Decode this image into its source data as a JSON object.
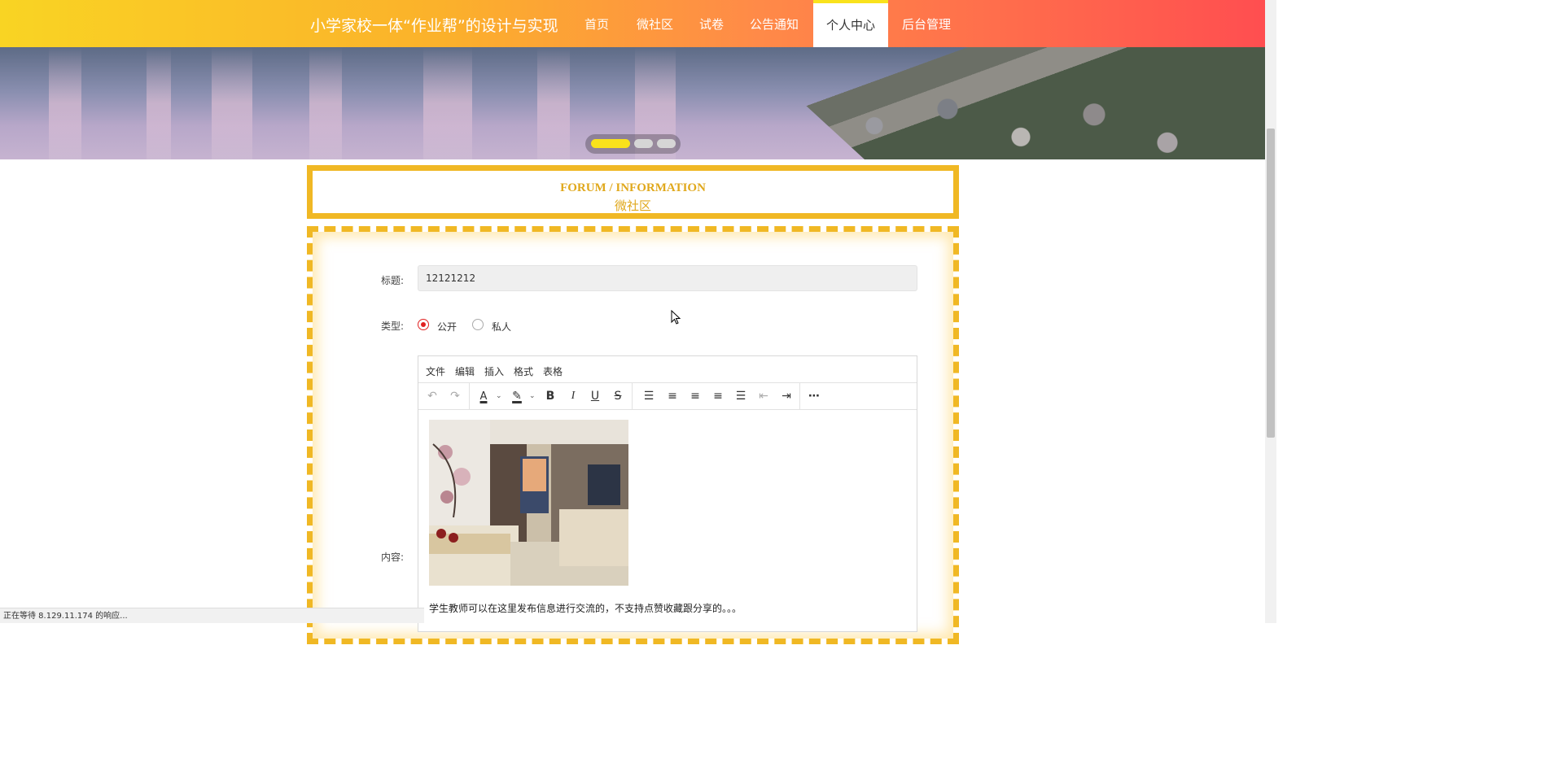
{
  "header": {
    "site_title": "小学家校一体“作业帮”的设计与实现",
    "nav": [
      {
        "label": "首页"
      },
      {
        "label": "微社区"
      },
      {
        "label": "试卷"
      },
      {
        "label": "公告通知"
      },
      {
        "label": "个人中心",
        "active": true
      },
      {
        "label": "后台管理"
      }
    ]
  },
  "banner": {
    "slides": 3,
    "active_slide": 1
  },
  "section": {
    "title_en": "FORUM / INFORMATION",
    "title_cn": "微社区"
  },
  "form": {
    "title_label": "标题:",
    "title_value": "12121212",
    "type_label": "类型:",
    "type_options": [
      {
        "label": "公开",
        "selected": true
      },
      {
        "label": "私人",
        "selected": false
      }
    ],
    "content_label": "内容:",
    "editor": {
      "menus": [
        "文件",
        "编辑",
        "插入",
        "格式",
        "表格"
      ],
      "toolbar_icons": [
        "undo-icon",
        "redo-icon",
        "text-color-icon",
        "highlight-icon",
        "bold-icon",
        "italic-icon",
        "underline-icon",
        "strikethrough-icon",
        "line-height-icon",
        "align-left-icon",
        "align-center-icon",
        "align-right-icon",
        "align-justify-icon",
        "outdent-icon",
        "indent-icon",
        "more-icon"
      ],
      "content_text": "学生教师可以在这里发布信息进行交流的，不支持点赞收藏跟分享的。。。"
    }
  },
  "status_bar": {
    "text": "正在等待 8.129.11.174 的响应..."
  },
  "colors": {
    "accent_yellow": "#f0b824",
    "header_start": "#f9d423",
    "header_end": "#ff4e50",
    "radio_red": "#e02020"
  }
}
